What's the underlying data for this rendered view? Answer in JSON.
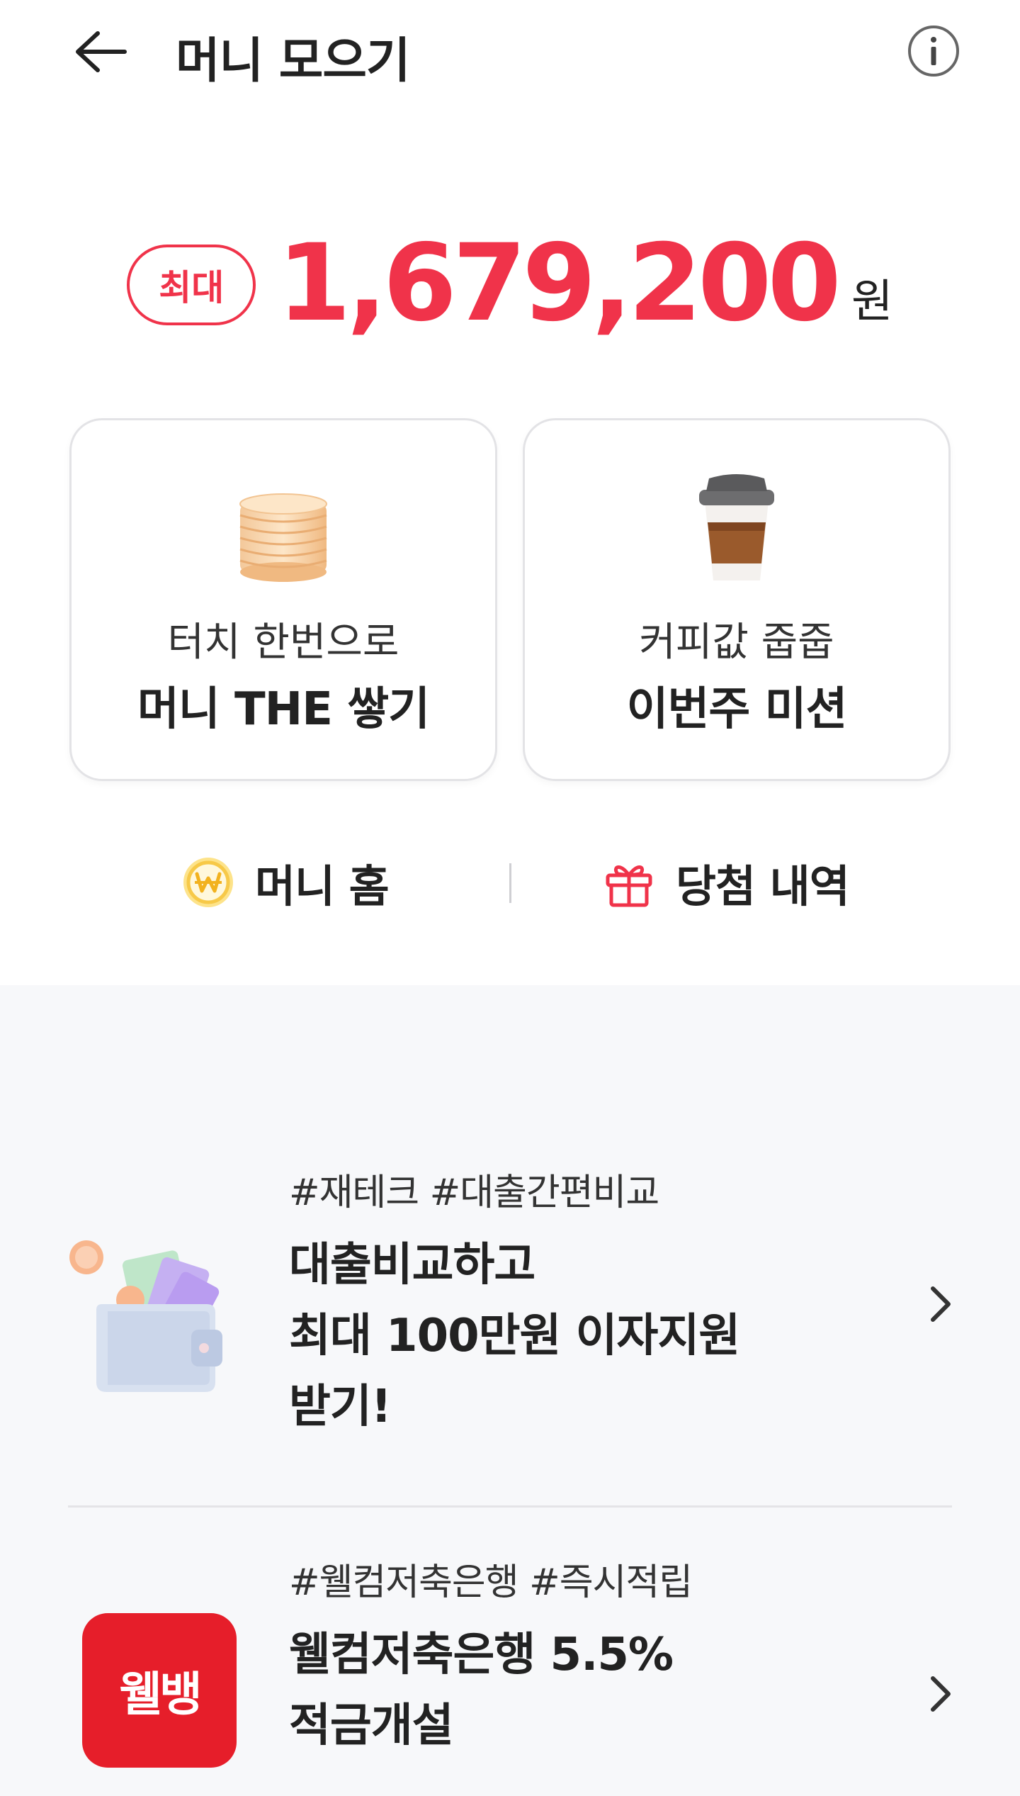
{
  "header": {
    "title": "머니 모으기",
    "back_icon": "arrow-left-icon",
    "info_icon": "info-circle-icon"
  },
  "hero": {
    "badge": "최대",
    "amount": "1,679,200",
    "unit": "원"
  },
  "cards": [
    {
      "subtitle": "터치 한번으로",
      "title": "머니 THE 쌓기",
      "icon": "coin-stack-icon"
    },
    {
      "subtitle": "커피값 줍줍",
      "title": "이번주 미션",
      "icon": "coffee-cup-icon"
    }
  ],
  "links": {
    "money_home": {
      "label": "머니 홈",
      "icon": "won-coin-icon"
    },
    "winning_history": {
      "label": "당첨 내역",
      "icon": "gift-icon"
    }
  },
  "promos": [
    {
      "tags": "#재테크 #대출간편비교",
      "title_lines": [
        "대출비교하고",
        "최대 100만원 이자지원",
        "받기!"
      ],
      "icon": "wallet-cards-icon"
    },
    {
      "tags": "#웰컴저축은행 #즉시적립",
      "title_lines": [
        "웰컴저축은행 5.5%",
        "적금개설"
      ],
      "logo_text": "웰뱅",
      "icon": "welbank-logo-icon"
    }
  ],
  "colors": {
    "accent": "#f0334a",
    "coin_yellow": "#f7c948",
    "welbank_red": "#e61e2a",
    "lower_bg": "#f7f8fa"
  }
}
